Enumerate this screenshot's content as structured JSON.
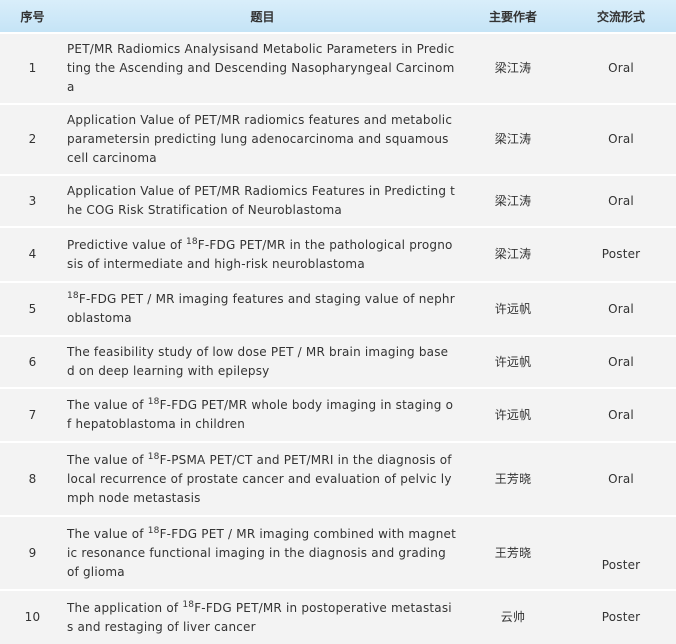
{
  "header": {
    "no": "序号",
    "title": "题目",
    "author": "主要作者",
    "type": "交流形式"
  },
  "rows": [
    {
      "no": "1",
      "sup": "",
      "title": "PET/MR Radiomics Analysisand Metabolic Parameters in Predicting the Ascending and Descending Nasopharyngeal Carcinoma",
      "author": "梁江涛",
      "type": "Oral"
    },
    {
      "no": "2",
      "sup": "",
      "title": "Application Value of PET/MR radiomics features and metabolic parametersin predicting lung adenocarcinoma and squamous cell carcinoma",
      "author": "梁江涛",
      "type": "Oral"
    },
    {
      "no": "3",
      "sup": "",
      "title": "Application Value of PET/MR Radiomics Features in Predicting the COG Risk Stratification of Neuroblastoma",
      "author": "梁江涛",
      "type": "Oral"
    },
    {
      "no": "4",
      "pre": "Predictive value of ",
      "sup": "18",
      "title": "F-FDG PET/MR in the pathological prognosis of intermediate and high-risk neuroblastoma",
      "author": "梁江涛",
      "type": "Poster"
    },
    {
      "no": "5",
      "pre": "",
      "sup": "18",
      "title": "F-FDG PET / MR imaging features and staging value of nephroblastoma",
      "author": "许远帆",
      "type": "Oral"
    },
    {
      "no": "6",
      "sup": "",
      "title": "The feasibility study of low dose PET / MR brain imaging based on deep learning with epilepsy",
      "author": "许远帆",
      "type": "Oral"
    },
    {
      "no": "7",
      "pre": "The value of ",
      "sup": "18",
      "title": "F-FDG PET/MR whole body imaging in staging of hepatoblastoma in children",
      "author": "许远帆",
      "type": "Oral"
    },
    {
      "no": "8",
      "pre": "The value of ",
      "sup": "18",
      "title": "F-PSMA PET/CT and PET/MRI in the diagnosis of local recurrence of prostate cancer and evaluation of pelvic lymph node metastasis",
      "author": "王芳晓",
      "type": "Oral"
    },
    {
      "no": "9",
      "pre": "The value of ",
      "sup": "18",
      "title": "F-FDG PET / MR imaging combined with magnetic resonance functional imaging in the diagnosis and grading of glioma",
      "author": "王芳晓",
      "type": "Poster"
    },
    {
      "no": "10",
      "pre": "The application of ",
      "sup": "18",
      "title": "F-FDG PET/MR in postoperative metastasis and restaging of liver cancer",
      "author": "云帅",
      "type": "Poster"
    }
  ]
}
